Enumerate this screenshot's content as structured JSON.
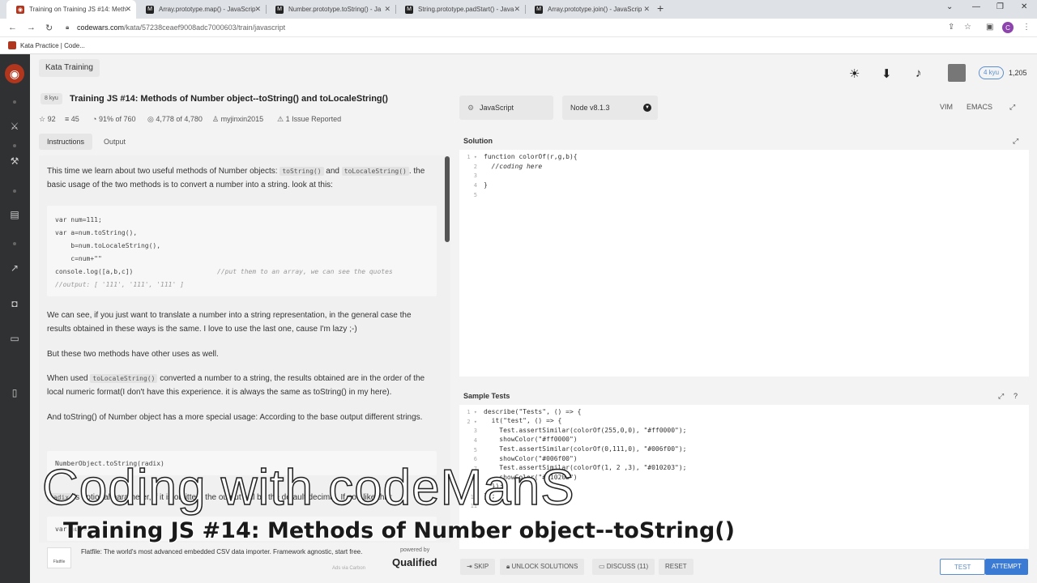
{
  "browser": {
    "tabs": [
      {
        "title": "Training on Training JS #14: Meth",
        "active": true,
        "favicon": "codewars-icon"
      },
      {
        "title": "Array.prototype.map() - JavaScrip",
        "favicon": "mdn-icon"
      },
      {
        "title": "Number.prototype.toString() - Ja",
        "favicon": "mdn-icon"
      },
      {
        "title": "String.prototype.padStart() - Java",
        "favicon": "mdn-icon"
      },
      {
        "title": "Array.prototype.join() - JavaScrip",
        "favicon": "mdn-icon"
      }
    ],
    "url_host": "codewars.com",
    "url_path": "/kata/57238ceaef9008adc7000603/train/javascript",
    "profile_initial": "C",
    "bookmark": "Kata Practice | Code..."
  },
  "header": {
    "section_label": "Kata Training",
    "rank": "4 kyu",
    "honor": "1,205"
  },
  "kata": {
    "kyu": "8 kyu",
    "title": "Training JS #14: Methods of Number object--toString() and toLocaleString()",
    "stars": "92",
    "collections": "45",
    "satisfaction": "91% of 760",
    "completed": "4,778 of 4,780",
    "author": "myjinxin2015",
    "issues": "1 Issue Reported"
  },
  "language": {
    "selected": "JavaScript",
    "version": "Node v8.1.3"
  },
  "editor_modes": [
    "VIM",
    "EMACS"
  ],
  "tabs": {
    "instructions": "Instructions",
    "output": "Output"
  },
  "description": {
    "p1_a": "This time we learn about two useful methods of Number objects: ",
    "p1_code1": "toString()",
    "p1_and": " and ",
    "p1_code2": "toLocaleString()",
    "p1_b": ". the basic usage of the two methods is to convert a number into a string. look at this:",
    "code1": [
      "var num=111;",
      "var a=num.toString(),",
      "    b=num.toLocaleString(),",
      "    c=num+\"\"",
      "console.log([a,b,c])"
    ],
    "code1_comment1": "//put them to an array, we can see the quotes",
    "code1_comment2": "//output: [ '111', '111', '111' ]",
    "p2": "We can see, if you just want to translate a number into a string representation, in the general case the results obtained in these ways is the same. I love to use the last one, cause I'm lazy ;-)",
    "p3": "But these two methods have other uses as well.",
    "p4_a": "When used ",
    "p4_code": "toLocaleString()",
    "p4_b": " converted a number to a string, the results obtained are in the order of the local numeric format(I don't have this experience. it is always the same as toString() in my here).",
    "p5": "And toString() of Number object has a more special usage: According to the base output different strings.",
    "code2": "NumberObject.toString(radix)",
    "p6_code": "radix",
    "p6": " is optional parameter, if it is omitted, the output will be the default decimal. If not, like this:",
    "code3": "var num=..."
  },
  "ad": {
    "logo_text": "Flatfile",
    "text": "Flatfile: The world's most advanced embedded CSV data importer. Framework agnostic, start free.",
    "powered": "powered by",
    "brand": "Qualified",
    "via": "Ads via Carbon"
  },
  "solution": {
    "label": "Solution",
    "lines": [
      "function colorOf(r,g,b){",
      "  //coding here",
      "",
      "}",
      ""
    ]
  },
  "tests": {
    "label": "Sample Tests",
    "lines": [
      "describe(\"Tests\", () => {",
      "  it(\"test\", () => {",
      "    Test.assertSimilar(colorOf(255,0,0), \"#ff0000\");",
      "    showColor(\"#ff0000\")",
      "    Test.assertSimilar(colorOf(0,111,0), \"#006f00\");",
      "    showColor(\"#006f00\")",
      "    Test.assertSimilar(colorOf(1, 2 ,3), \"#010203\");",
      "    showColor(\"#010203\")",
      "  });",
      "});",
      ""
    ]
  },
  "actions": {
    "skip": "SKIP",
    "unlock": "UNLOCK SOLUTIONS",
    "discuss": "DISCUSS (11)",
    "reset": "RESET",
    "test": "TEST",
    "attempt": "ATTEMPT"
  },
  "overlay": {
    "title": "Coding with codeManS",
    "subtitle": "Training JS #14: Methods of Number object--toString()"
  }
}
